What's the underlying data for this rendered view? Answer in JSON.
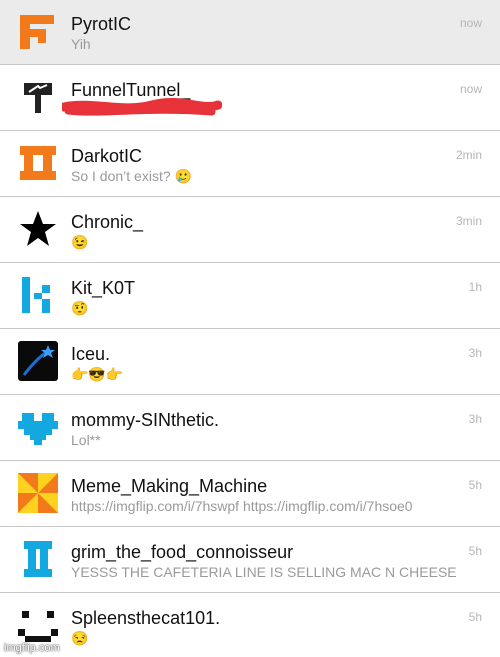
{
  "conversations": [
    {
      "name": "PyrotIC",
      "preview": "Yih",
      "time": "now",
      "avatar": "pyrotic-logo-icon",
      "selected": true
    },
    {
      "name": "FunnelTunnel_",
      "preview": "",
      "time": "now",
      "avatar": "signpost-icon",
      "redacted": true
    },
    {
      "name": "DarkotIC",
      "preview": "So I don’t exist? 🥲",
      "time": "2min",
      "avatar": "darkotic-logo-icon"
    },
    {
      "name": "Chronic_",
      "preview": "😉",
      "time": "3min",
      "avatar": "star-icon"
    },
    {
      "name": "Kit_K0T",
      "preview": "🤨",
      "time": "1h",
      "avatar": "k-logo-icon"
    },
    {
      "name": "Iceu.",
      "preview": "👉😎👉",
      "time": "3h",
      "avatar": "shooting-star-icon"
    },
    {
      "name": "mommy-SINthetic.",
      "preview": "Lol**",
      "time": "3h",
      "avatar": "pixel-heart-icon"
    },
    {
      "name": "Meme_Making_Machine",
      "preview": "https://imgflip.com/i/7hswpf https://imgflip.com/i/7hsoe0",
      "time": "5h",
      "avatar": "pinwheel-icon"
    },
    {
      "name": "grim_the_food_connoisseur",
      "preview": "YESSS THE CAFETERIA LINE IS SELLING MAC N CHEESE",
      "time": "5h",
      "avatar": "pixel-bracket-icon"
    },
    {
      "name": "Spleensthecat101.",
      "preview": "😒",
      "time": "5h",
      "avatar": "pixel-smiley-icon"
    }
  ],
  "colors": {
    "orange": "#f27a1a",
    "cyan": "#14a8e0",
    "redaction": "#e8323a",
    "selected_row": "#ebebeb"
  },
  "watermark": "imgflip.com"
}
